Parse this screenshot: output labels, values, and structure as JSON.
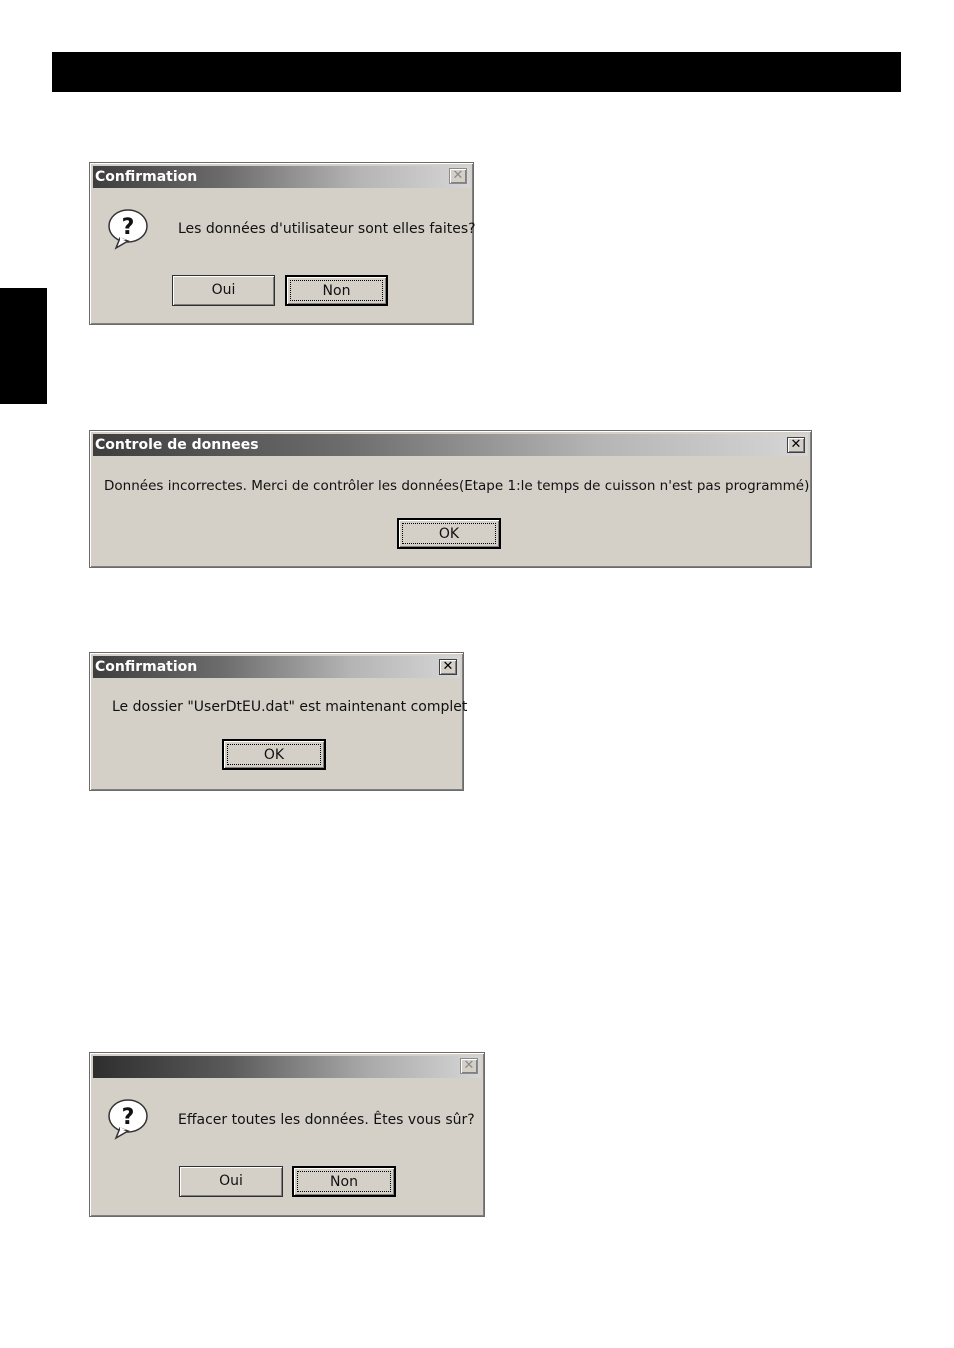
{
  "dialogs": [
    {
      "title": "Confirmation",
      "message": "Les données d'utilisateur sont elles faites?",
      "icon": "question-icon",
      "buttons": {
        "yes": "Oui",
        "no": "Non"
      }
    },
    {
      "title": "Controle de donnees",
      "message": "Données incorrectes.  Merci de contrôler les données(Etape 1:le temps de cuisson n'est pas programmé)",
      "buttons": {
        "ok": "OK"
      }
    },
    {
      "title": "Confirmation",
      "message": "Le dossier \"UserDtEU.dat\" est maintenant complet",
      "buttons": {
        "ok": "OK"
      }
    },
    {
      "title": "",
      "message": "Effacer toutes les données.  Êtes vous sûr?",
      "icon": "question-icon",
      "buttons": {
        "yes": "Oui",
        "no": "Non"
      }
    }
  ],
  "close_glyph": "✕",
  "colors": {
    "dialog_face": "#d4d0c8",
    "header_bar": "#000000"
  }
}
